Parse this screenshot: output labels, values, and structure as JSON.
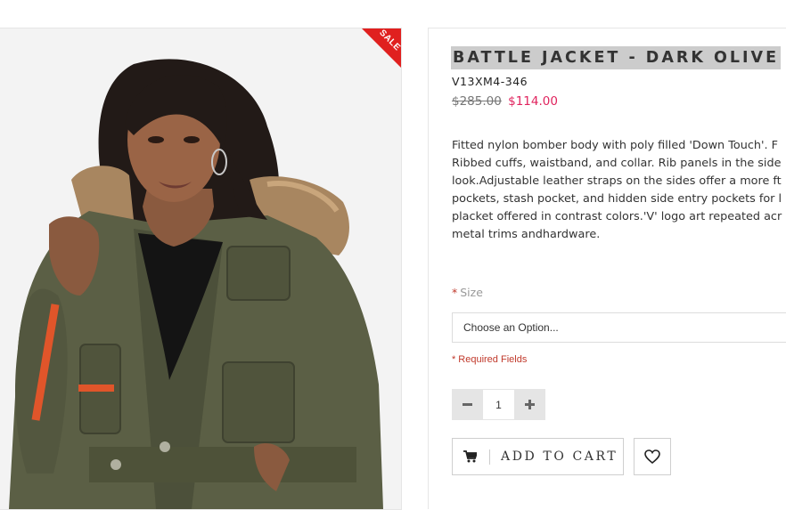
{
  "product": {
    "title": "BATTLE JACKET - DARK OLIVE",
    "sku": "V13XM4-346",
    "old_price": "$285.00",
    "new_price": "$114.00",
    "sale_badge": "SALE",
    "description_lines": [
      "Fitted nylon bomber body with poly filled 'Down Touch'. F",
      "Ribbed cuffs, waistband, and collar. Rib panels in the side",
      "look.Adjustable leather straps on the sides offer a more ft",
      "pockets, stash pocket, and hidden side entry pockets for l",
      "placket offered in contrast colors.'V' logo art repeated acr",
      "metal trims andhardware."
    ]
  },
  "options": {
    "size_label": "Size",
    "required_star": "*",
    "size_select_value": "Choose an Option...",
    "required_note": "Required Fields"
  },
  "quantity": {
    "value": "1",
    "minus_icon": "minus-icon",
    "plus_icon": "plus-icon"
  },
  "actions": {
    "add_to_cart": "ADD TO CART",
    "cart_icon": "cart-icon",
    "wishlist_icon": "heart-icon"
  },
  "colors": {
    "sale_badge": "#e0201f",
    "new_price": "#e0245e",
    "required": "#c0392b",
    "title_highlight": "#cccccc"
  }
}
